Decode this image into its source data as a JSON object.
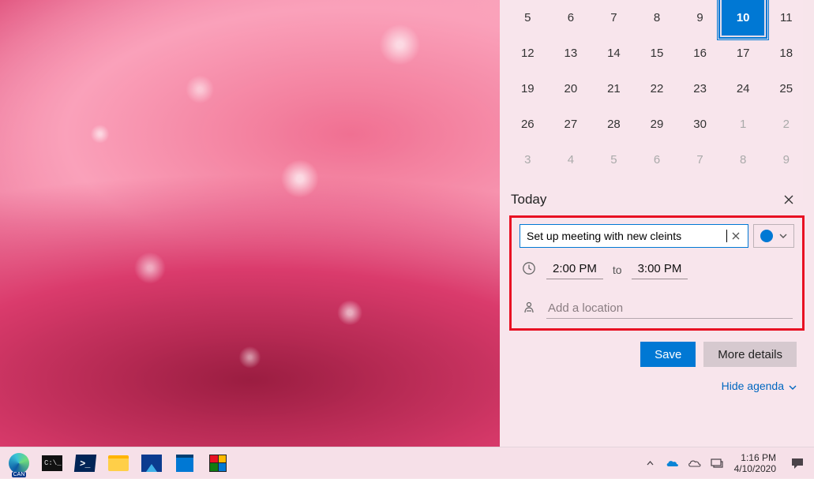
{
  "calendar": {
    "selected_day": 10,
    "rows": [
      [
        {
          "d": 5
        },
        {
          "d": 6
        },
        {
          "d": 7
        },
        {
          "d": 8
        },
        {
          "d": 9
        },
        {
          "d": 10,
          "sel": true
        },
        {
          "d": 11
        }
      ],
      [
        {
          "d": 12
        },
        {
          "d": 13
        },
        {
          "d": 14
        },
        {
          "d": 15
        },
        {
          "d": 16
        },
        {
          "d": 17
        },
        {
          "d": 18
        }
      ],
      [
        {
          "d": 19
        },
        {
          "d": 20
        },
        {
          "d": 21
        },
        {
          "d": 22
        },
        {
          "d": 23
        },
        {
          "d": 24
        },
        {
          "d": 25
        }
      ],
      [
        {
          "d": 26
        },
        {
          "d": 27
        },
        {
          "d": 28
        },
        {
          "d": 29
        },
        {
          "d": 30
        },
        {
          "d": 1,
          "nm": true
        },
        {
          "d": 2,
          "nm": true
        }
      ],
      [
        {
          "d": 3,
          "nm": true
        },
        {
          "d": 4,
          "nm": true
        },
        {
          "d": 5,
          "nm": true
        },
        {
          "d": 6,
          "nm": true
        },
        {
          "d": 7,
          "nm": true
        },
        {
          "d": 8,
          "nm": true
        },
        {
          "d": 9,
          "nm": true
        }
      ]
    ]
  },
  "agenda": {
    "title": "Today"
  },
  "event": {
    "title_value": "Set up meeting with new cleints",
    "start_time": "2:00 PM",
    "to_label": "to",
    "end_time": "3:00 PM",
    "location_placeholder": "Add a location",
    "category_color": "#0078d4"
  },
  "buttons": {
    "save": "Save",
    "more_details": "More details"
  },
  "hide_agenda": "Hide agenda",
  "taskbar": {
    "edge_label": "CAN",
    "clock": {
      "time": "1:16 PM",
      "date": "4/10/2020"
    }
  }
}
